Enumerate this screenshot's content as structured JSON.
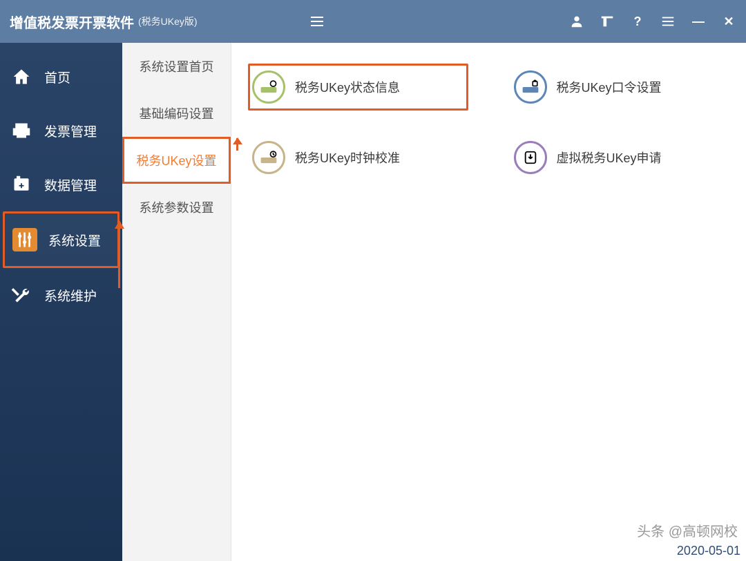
{
  "titlebar": {
    "main": "增值税发票开票软件",
    "sub": "(税务UKey版)"
  },
  "sidebar": {
    "items": [
      {
        "label": "首页"
      },
      {
        "label": "发票管理"
      },
      {
        "label": "数据管理"
      },
      {
        "label": "系统设置"
      },
      {
        "label": "系统维护"
      }
    ]
  },
  "subpanel": {
    "items": [
      {
        "label": "系统设置首页"
      },
      {
        "label": "基础编码设置"
      },
      {
        "label": "税务UKey设置"
      },
      {
        "label": "系统参数设置"
      }
    ]
  },
  "cards": {
    "status": {
      "label": "税务UKey状态信息"
    },
    "password": {
      "label": "税务UKey口令设置"
    },
    "clock": {
      "label": "税务UKey时钟校准"
    },
    "virtual": {
      "label": "虚拟税务UKey申请"
    }
  },
  "footer": {
    "watermark": "头条 @高顿网校",
    "date": "2020-05-01"
  }
}
